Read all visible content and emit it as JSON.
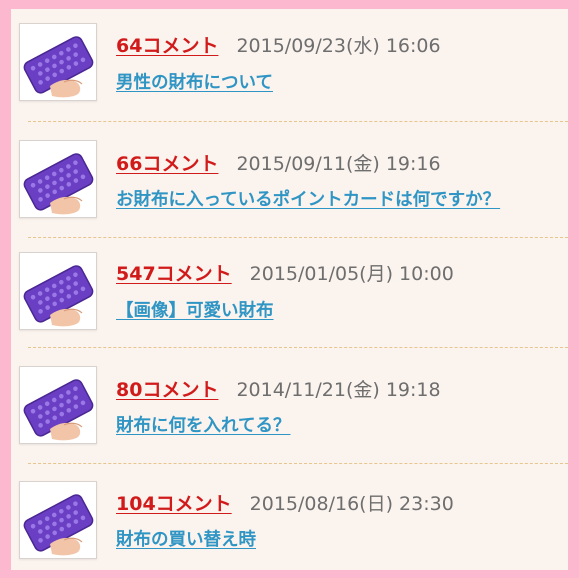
{
  "colors": {
    "outer_border": "#fbb8cf",
    "panel_background": "#fbf3ee",
    "comment_count": "#d11b1b",
    "title_link": "#2f95c4",
    "date_text": "#6e6e6e",
    "divider": "#e8c58c"
  },
  "items": [
    {
      "thumbnail": "purple-wallet-thumbnail",
      "comments": "64コメント",
      "date": "2015/09/23(水) 16:06",
      "title": "男性の財布について"
    },
    {
      "thumbnail": "purple-wallet-thumbnail",
      "comments": "66コメント",
      "date": "2015/09/11(金) 19:16",
      "title": "お財布に入っているポイントカードは何ですか？"
    },
    {
      "thumbnail": "purple-wallet-thumbnail",
      "comments": "547コメント",
      "date": "2015/01/05(月) 10:00",
      "title": "【画像】可愛い財布"
    },
    {
      "thumbnail": "purple-wallet-thumbnail",
      "comments": "80コメント",
      "date": "2014/11/21(金) 19:18",
      "title": "財布に何を入れてる？"
    },
    {
      "thumbnail": "purple-wallet-thumbnail",
      "comments": "104コメント",
      "date": "2015/08/16(日) 23:30",
      "title": "財布の買い替え時"
    }
  ]
}
